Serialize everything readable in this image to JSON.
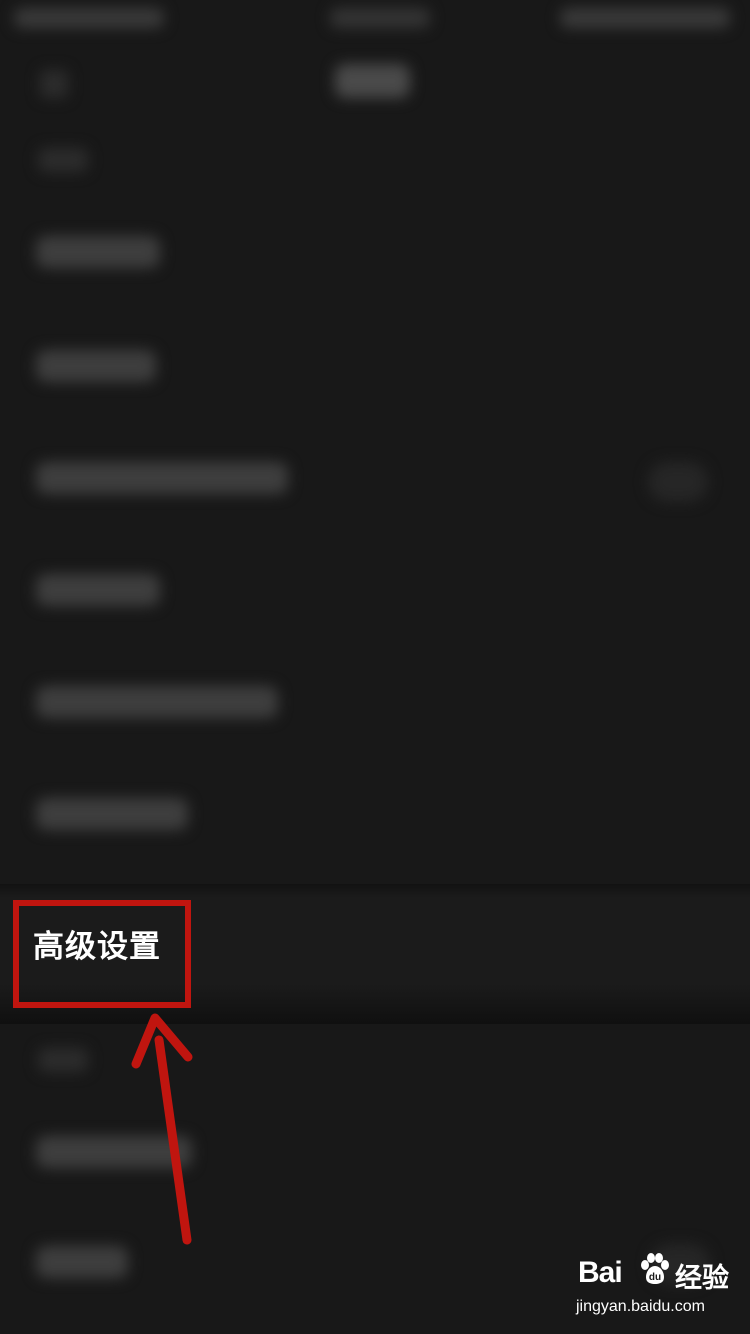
{
  "settings": {
    "highlighted_item_label": "高级设置"
  },
  "watermark": {
    "brand_left": "Bai",
    "brand_right": "经验",
    "url": "jingyan.baidu.com"
  },
  "colors": {
    "background": "#181818",
    "highlight_border": "#c0150f",
    "arrow": "#c0150f",
    "text": "#ffffff"
  },
  "icons": [
    "back-icon",
    "arrow-pointer-icon",
    "baidu-paw-icon"
  ]
}
